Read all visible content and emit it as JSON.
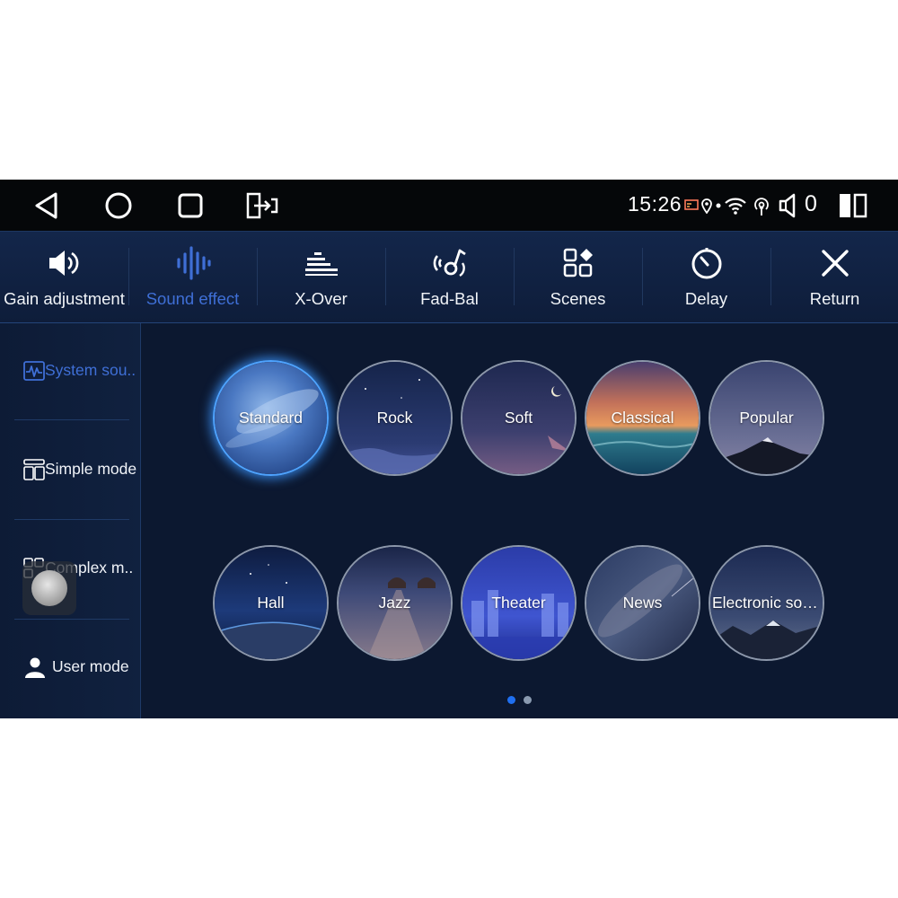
{
  "status": {
    "time": "15:26",
    "volume_level": "0"
  },
  "nav": {
    "back_icon": "back-triangle-icon",
    "home_icon": "home-circle-icon",
    "recents_icon": "recents-square-icon",
    "screen_icon": "screen-switch-icon"
  },
  "toolbar": {
    "items": [
      {
        "label": "Gain adjustment",
        "icon": "speaker-icon",
        "active": false
      },
      {
        "label": "Sound effect",
        "icon": "waveform-icon",
        "active": true
      },
      {
        "label": "X-Over",
        "icon": "equalizer-bars-icon",
        "active": false
      },
      {
        "label": "Fad-Bal",
        "icon": "fader-balance-icon",
        "active": false
      },
      {
        "label": "Scenes",
        "icon": "scenes-grid-icon",
        "active": false
      },
      {
        "label": "Delay",
        "icon": "timer-icon",
        "active": false
      },
      {
        "label": "Return",
        "icon": "close-icon",
        "active": false
      }
    ]
  },
  "sidebar": {
    "items": [
      {
        "label": "System sou..",
        "icon": "waveform-box-icon",
        "active": true
      },
      {
        "label": "Simple mode",
        "icon": "simple-mode-icon",
        "active": false
      },
      {
        "label": "Complex m..",
        "icon": "complex-mode-icon",
        "active": false
      },
      {
        "label": "User mode",
        "icon": "user-icon",
        "active": false
      }
    ]
  },
  "effects": {
    "selected": "Standard",
    "tiles": [
      {
        "label": "Standard"
      },
      {
        "label": "Rock"
      },
      {
        "label": "Soft"
      },
      {
        "label": "Classical"
      },
      {
        "label": "Popular"
      },
      {
        "label": "Hall"
      },
      {
        "label": "Jazz"
      },
      {
        "label": "Theater"
      },
      {
        "label": "News"
      },
      {
        "label": "Electronic soun.."
      }
    ]
  },
  "pager": {
    "pages": 2,
    "current": 1
  },
  "colors": {
    "accent": "#3f6fd6",
    "background": "#0c1830",
    "status_bar": "#050709"
  }
}
